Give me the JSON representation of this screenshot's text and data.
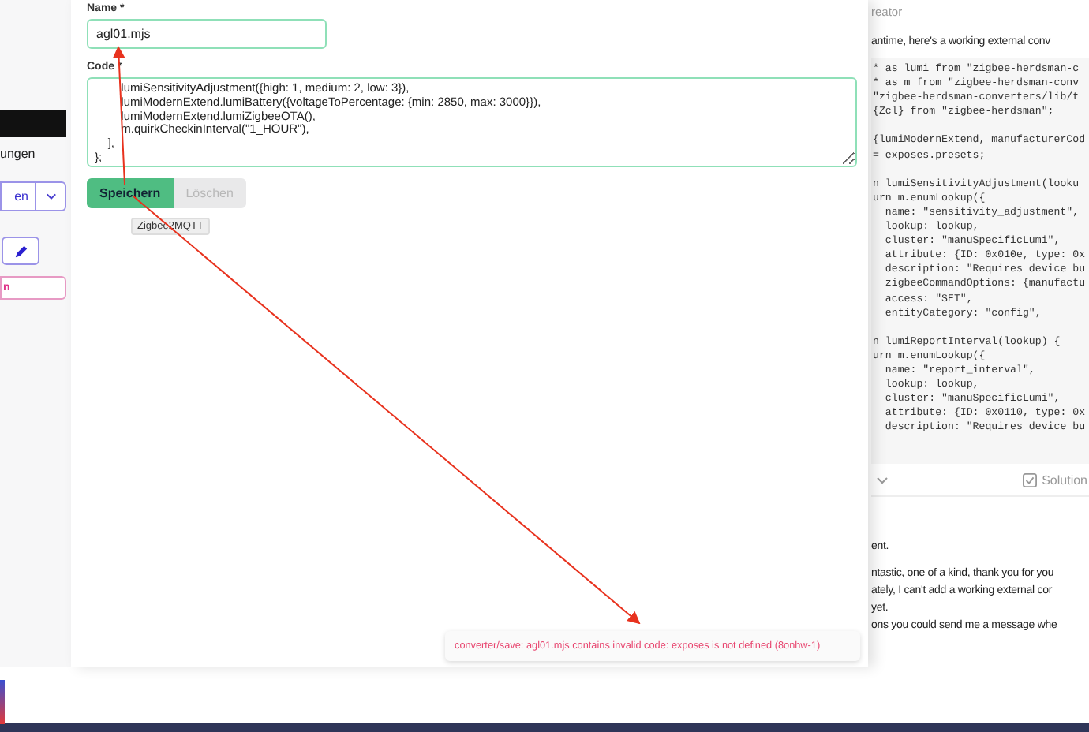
{
  "sidebar": {
    "items": [
      {
        "kind": "dark-bar"
      },
      {
        "kind": "text",
        "text": "ungen"
      },
      {
        "kind": "dropdown",
        "label": "en"
      },
      {
        "kind": "icon-button"
      },
      {
        "kind": "outline-button",
        "label": "n"
      }
    ]
  },
  "form": {
    "name_label": "Name *",
    "name_value": "agl01.mjs",
    "code_label": "Code *",
    "code_lines": [
      "        lumiSensitivityAdjustment({high: 1, medium: 2, low: 3}),",
      "        lumiModernExtend.lumiBattery({voltageToPercentage: {min: 2850, max: 3000}}),",
      "        lumiModernExtend.lumiZigbeeOTA(),",
      "        m.quirkCheckinInterval(\"1_HOUR\"),",
      "    ],",
      "};"
    ],
    "buttons": [
      {
        "label": "Speichern",
        "disabled": false
      },
      {
        "label": "Löschen",
        "disabled": true
      }
    ],
    "tooltip": "Zigbee2MQTT"
  },
  "toast": {
    "message": "converter/save: agl01.mjs contains invalid code: exposes is not defined (8onhw-1)"
  },
  "background_post": {
    "author": "reator",
    "intro": "antime, here's a working external conv",
    "code_blocks": [
      [
        "* as lumi from \"zigbee-herdsman-c",
        "* as m from \"zigbee-herdsman-conv",
        "\"zigbee-herdsman-converters/lib/t",
        "{Zcl} from \"zigbee-herdsman\";"
      ],
      [
        "{lumiModernExtend, manufacturerCod",
        "= exposes.presets;"
      ],
      [
        "n lumiSensitivityAdjustment(looku",
        "urn m.enumLookup({",
        "  name: \"sensitivity_adjustment\",",
        "  lookup: lookup,",
        "  cluster: \"manuSpecificLumi\",",
        "  attribute: {ID: 0x010e, type: 0x",
        "  description: \"Requires device bu",
        "  zigbeeCommandOptions: {manufactu",
        "  access: \"SET\",",
        "  entityCategory: \"config\","
      ],
      [
        "n lumiReportInterval(lookup) {",
        "urn m.enumLookup({",
        "  name: \"report_interval\",",
        "  lookup: lookup,",
        "  cluster: \"manuSpecificLumi\",",
        "  attribute: {ID: 0x0110, type: 0x",
        "  description: \"Requires device bu"
      ]
    ],
    "solution_label": "Solution",
    "reply_lines": [
      "ent.",
      "ntastic, one of a kind, thank you for you",
      "ately, I can't add a working external cor",
      "yet.",
      "ons you could send me a message whe"
    ]
  }
}
